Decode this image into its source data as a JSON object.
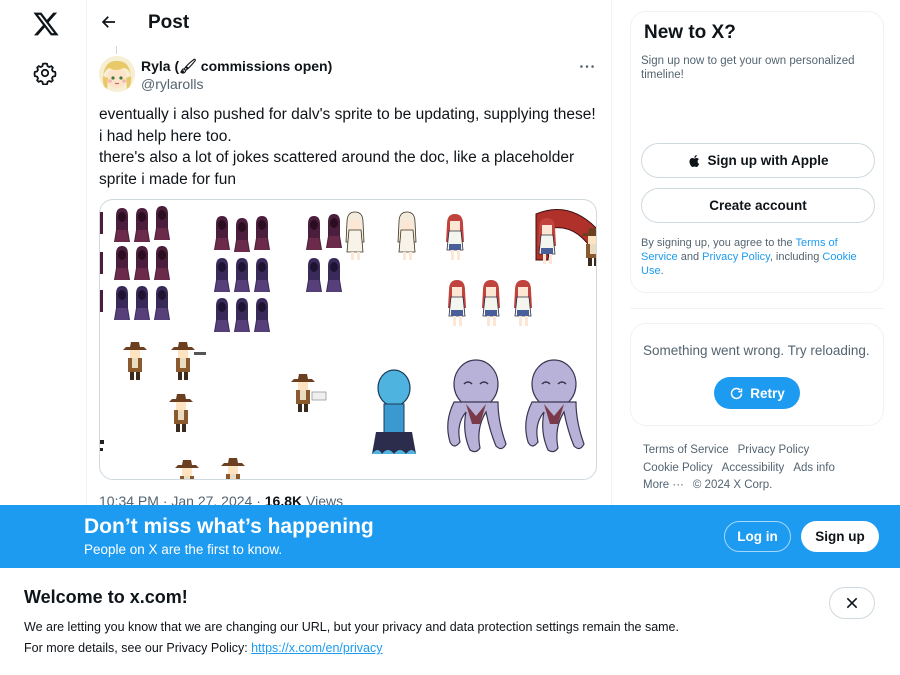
{
  "header": {
    "title": "Post"
  },
  "post": {
    "author_name": "Ryla (🖌 commissions open)",
    "author_handle": "@rylarolls",
    "text_lines": [
      "eventually i also pushed for dalv's sprite to be updating, supplying these!",
      "i had help here too.",
      "there's also a lot of jokes scattered around the doc, like a placeholder",
      "sprite i made for fun"
    ],
    "time": "10:34 PM · Jan 27, 2024 · ",
    "views_count": "16.8K",
    "views_label": " Views"
  },
  "signup_card": {
    "title": "New to X?",
    "subtitle": "Sign up now to get your own personalized timeline!",
    "apple_button": "Sign up with Apple",
    "create_button": "Create account",
    "legal_prefix": "By signing up, you agree to the ",
    "terms_link": "Terms of Service",
    "legal_and": " and ",
    "privacy_link": "Privacy Policy",
    "legal_including": ", including ",
    "cookie_link": "Cookie Use",
    "legal_end": "."
  },
  "error_card": {
    "message": "Something went wrong. Try reloading.",
    "retry_label": "Retry"
  },
  "footer": {
    "terms": "Terms of Service",
    "privacy": "Privacy Policy",
    "cookie": "Cookie Policy",
    "accessibility": "Accessibility",
    "ads": "Ads info",
    "more": "More ···",
    "copyright": "© 2024 X Corp."
  },
  "banner": {
    "title": "Don’t miss what’s happening",
    "subtitle": "People on X are the first to know.",
    "login_label": "Log in",
    "signup_label": "Sign up"
  },
  "notice": {
    "title": "Welcome to x.com!",
    "line1": "We are letting you know that we are changing our URL, but your privacy and data protection settings remain the same.",
    "line2_prefix": "For more details, see our Privacy Policy: ",
    "link": "https://x.com/en/privacy"
  },
  "colors": {
    "accent": "#1d9bf0",
    "text": "#0f1419",
    "muted": "#536471",
    "border": "#cfd9de"
  },
  "icons": [
    "x-logo-icon",
    "gear-icon",
    "arrow-left-icon",
    "more-dots-icon",
    "apple-icon",
    "retry-icon",
    "close-icon"
  ]
}
